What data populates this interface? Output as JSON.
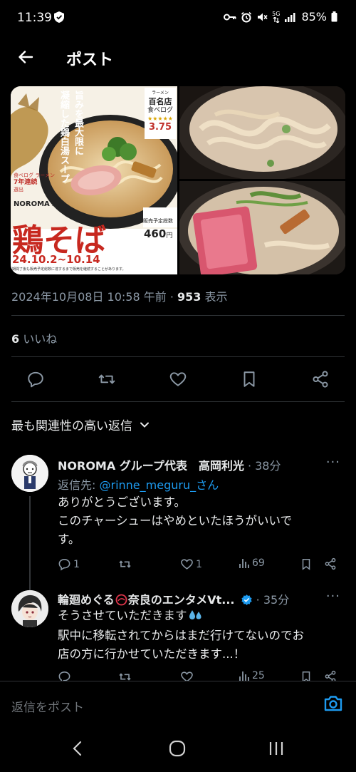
{
  "status_bar": {
    "time": "11:39",
    "battery_percent": "85%",
    "network_label": "5G"
  },
  "header": {
    "title": "ポスト"
  },
  "post": {
    "date_time": "2024年10月08日 10:58 午前",
    "separator": "·",
    "view_count": "953",
    "view_label": "表示",
    "like_count": "6",
    "like_label": "いいね",
    "image_text": {
      "vertical_copy_1": "旨みを最大限に",
      "vertical_copy_2": "凝縮した鶏白湯スープ",
      "award_line_1": "ラーメン",
      "award_line_2": "百名店",
      "award_site": "食べログ",
      "rating": "3.75",
      "brand": "NOROMA",
      "brand_suffix": "本店",
      "years_line_1": "食べログ ラーメン",
      "years_line_2": "7年連続",
      "years_line_3": "選出",
      "product": "鶏そば",
      "limited_label": "販売予定総数",
      "price": "460",
      "price_suffix": "円",
      "date_range_start": "24.10.2",
      "date_range_end": "10.14",
      "date_range_dash": "~",
      "footer_note": "期間了後も販売予定総数に達するまで販売を継続することがあります。"
    }
  },
  "sort": {
    "label": "最も関連性の高い返信"
  },
  "replies": [
    {
      "name": "NOROMA グループ代表　高岡利光",
      "time": "· 38分",
      "reply_to_prefix": "返信先: ",
      "reply_to_handle": "@rinne_meguru_さん",
      "text_line_1": "ありがとうございます。",
      "text_line_2": "このチャーシューはやめといたほうがいいで",
      "text_line_3": "す。",
      "replies_count": "1",
      "retweets_count": "",
      "likes_count": "1",
      "views_count": "69"
    },
    {
      "name": "輪廻めぐる",
      "name_suffix": "奈良のエンタメVt...",
      "time": "· 35分",
      "text_line_1": "そうさせていただきます",
      "text_line_2": "駅中に移転されてからはまだ行けてないのでお",
      "text_line_3": "店の方に行かせていただきます...！",
      "views_count": "25"
    }
  ],
  "compose": {
    "placeholder": "返信をポスト"
  },
  "colors": {
    "background": "#000000",
    "text_primary": "#e7e9ea",
    "text_secondary": "#8b98a5",
    "accent_link": "#1d9bf0",
    "divider": "#2f3336"
  }
}
